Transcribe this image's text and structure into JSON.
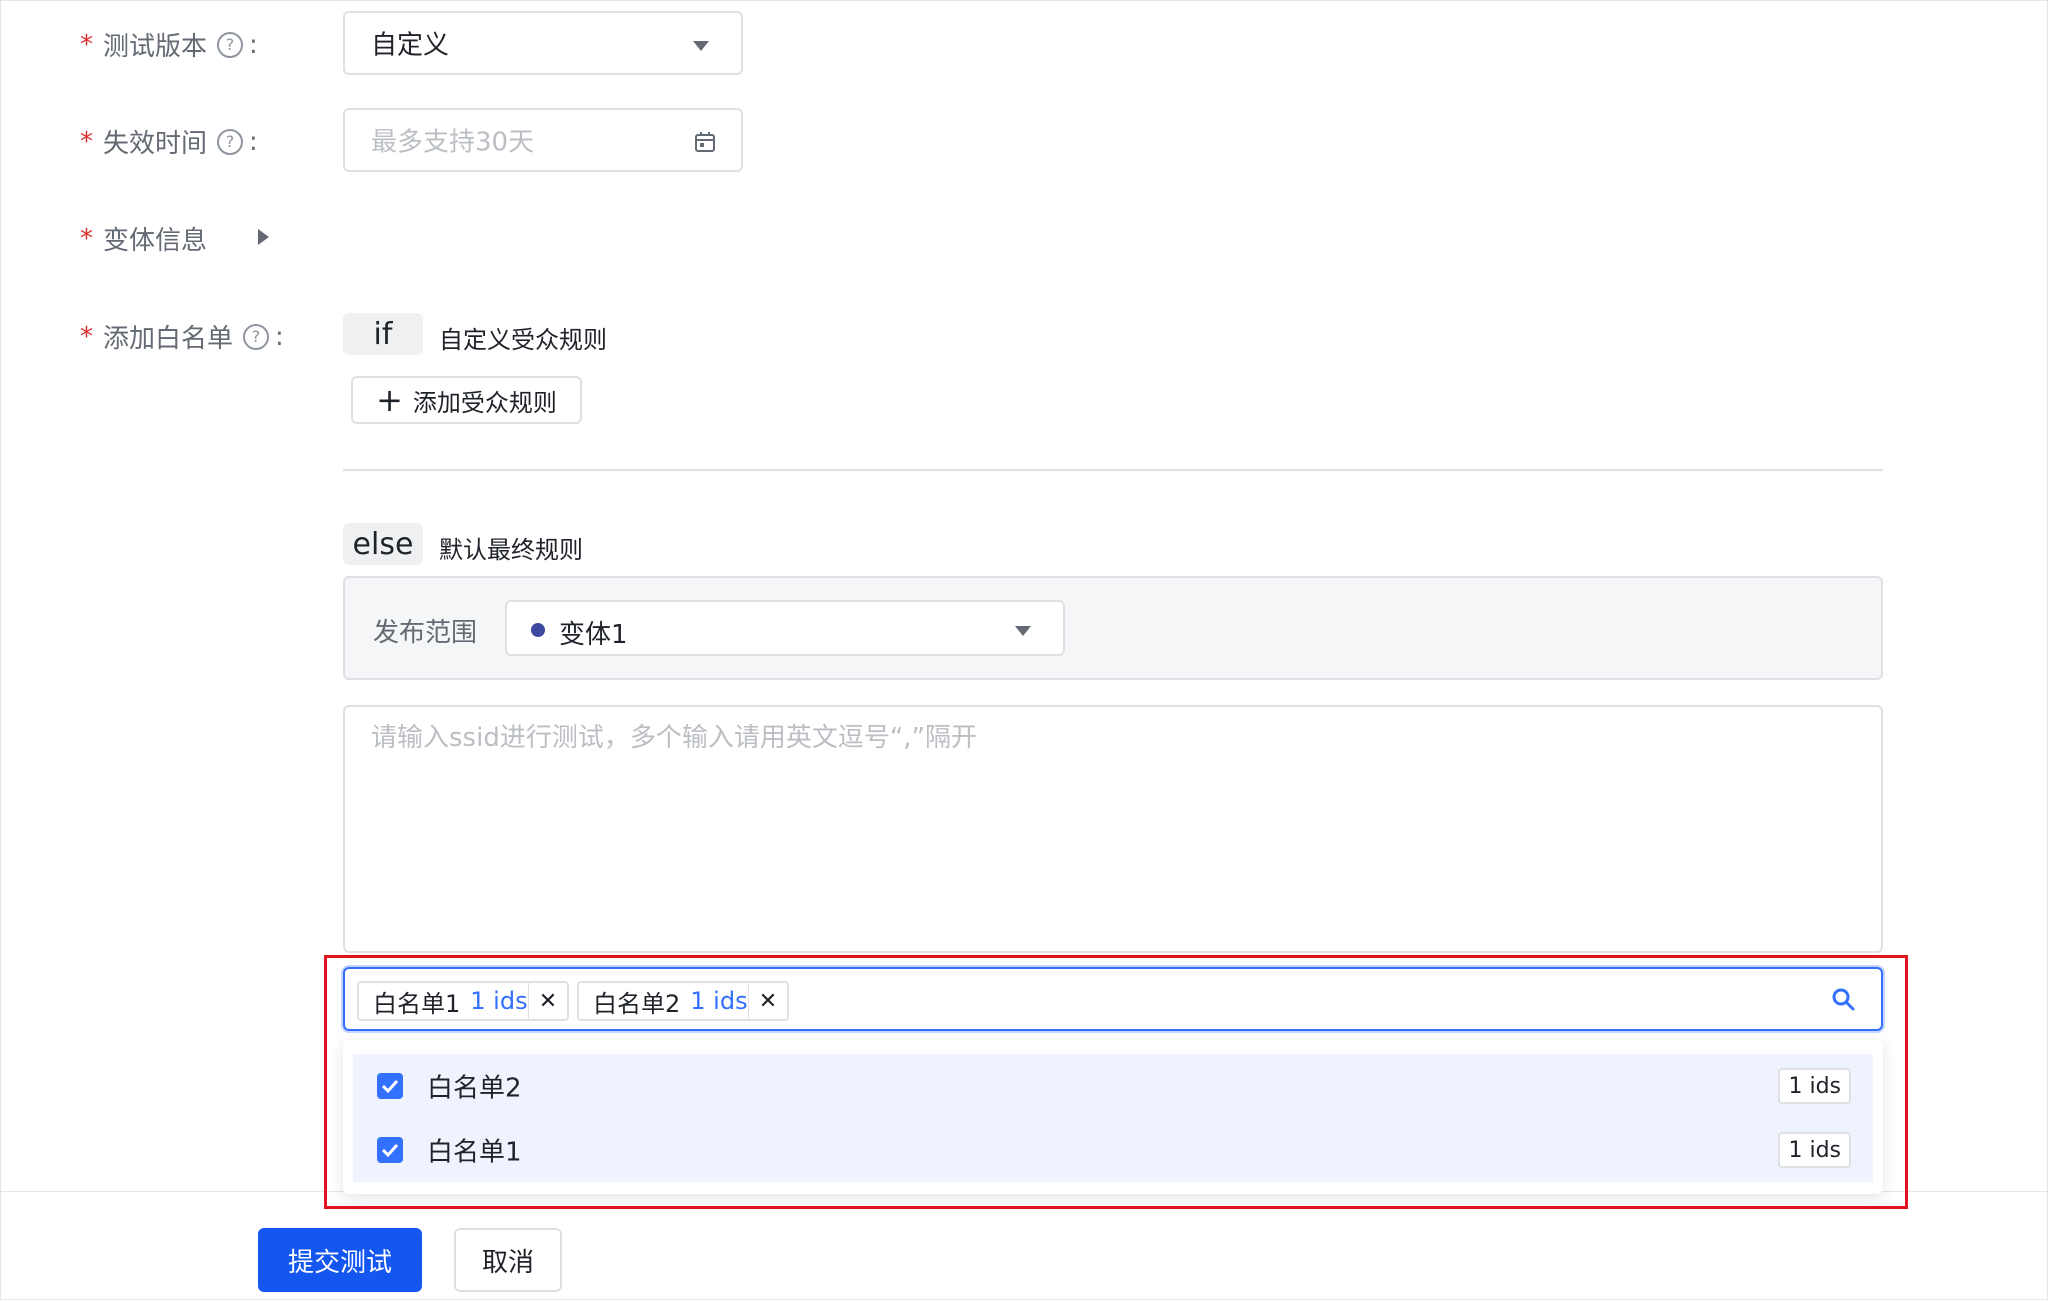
{
  "form": {
    "test_version": {
      "label": "测试版本",
      "help": "?",
      "value": "自定义"
    },
    "expire_time": {
      "label": "失效时间",
      "help": "?",
      "placeholder": "最多支持30天"
    },
    "variant_info": {
      "label": "变体信息"
    },
    "whitelist": {
      "label": "添加白名单",
      "help": "?"
    },
    "colon": ":"
  },
  "rules": {
    "if_keyword": "if",
    "if_desc": "自定义受众规则",
    "add_rule_button": "添加受众规则",
    "add_rule_icon": "+",
    "else_keyword": "else",
    "else_desc": "默认最终规则",
    "publish_scope_label": "发布范围",
    "publish_scope_value": "变体1",
    "publish_scope_dot_color": "#3c4ba0",
    "ssid_placeholder": "请输入ssid进行测试，多个输入请用英文逗号“,”隔开"
  },
  "whitelist_picker": {
    "selected_tags": [
      {
        "name": "白名单1",
        "count": "1 ids",
        "remove": "✕"
      },
      {
        "name": "白名单2",
        "count": "1 ids",
        "remove": "✕"
      }
    ],
    "options": [
      {
        "name": "白名单2",
        "count": "1 ids",
        "checked": true
      },
      {
        "name": "白名单1",
        "count": "1 ids",
        "checked": true
      }
    ],
    "highlight_color": "#e0141e",
    "accent_color": "#3370ff"
  },
  "footer": {
    "submit_button": "提交测试",
    "cancel_button": "取消"
  }
}
